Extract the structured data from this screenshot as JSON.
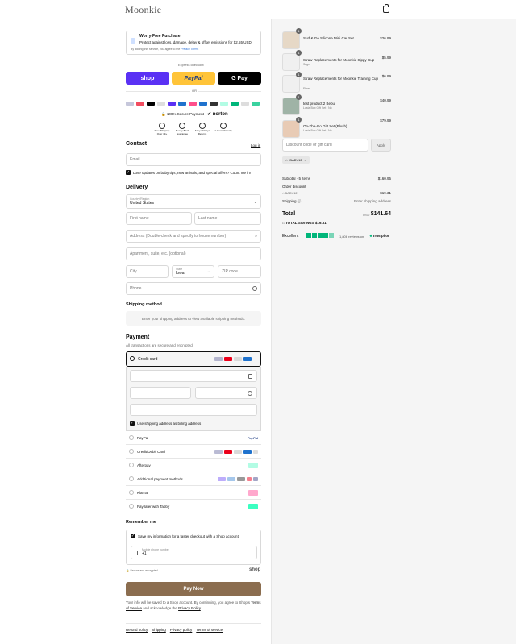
{
  "header": {
    "logo": "Moonkie"
  },
  "worry": {
    "title": "Worry-Free Purchase",
    "desc": "Protect against loss, damage, delay & offset emissions for $2.55 USD",
    "terms": "By adding this service, you agree to the",
    "terms_link": "Privacy Terms"
  },
  "express": {
    "label": "Express checkout",
    "shop": "shop",
    "paypal": "PayPal",
    "gpay": "G Pay",
    "or": "OR"
  },
  "trust": {
    "secure": "100% Secure Payment",
    "norton": "norton",
    "items": [
      "Free Shipping Over 79+",
      "Money Back Guarantee",
      "Easy 30 Days Returns",
      "1 Year Warranty"
    ]
  },
  "contact": {
    "title": "Contact",
    "login": "Log in",
    "email_placeholder": "Email",
    "newsletter": "Love updates on baby tips, new arrivals, and special offers? Count me in!"
  },
  "delivery": {
    "title": "Delivery",
    "country_label": "Country/Region",
    "country": "United States",
    "first": "First name",
    "last": "Last name",
    "address": "Address (Double-check and specify to house number)",
    "apt": "Apartment, suite, etc. (optional)",
    "city": "City",
    "state_label": "State",
    "state": "Iowa",
    "zip": "ZIP code",
    "phone": "Phone"
  },
  "shipping": {
    "title": "Shipping method",
    "msg": "Enter your shipping address to view available shipping methods."
  },
  "payment": {
    "title": "Payment",
    "subtitle": "All transactions are secure and encrypted.",
    "credit": "Credit card",
    "billing": "Use shipping address as billing address",
    "options": [
      "PayPal",
      "Credit/Debit Card",
      "Afterpay",
      "Additional payment methods",
      "Klarna",
      "Pay later with Tabby"
    ]
  },
  "remember": {
    "title": "Remember me",
    "save": "Save my information for a faster checkout with a Shop account",
    "mobile_label": "Mobile phone number",
    "mobile": "+1",
    "secure": "Secure and encrypted",
    "shop": "shop"
  },
  "paynow": "Pay Now",
  "legal": {
    "text1": "Your info will be saved to a Shop account. By continuing, you agree to Shop's",
    "tos": "Terms of Service",
    "text2": "and acknowledge the",
    "privacy": "Privacy Policy",
    "end": "."
  },
  "footer": [
    "Refund policy",
    "Shipping",
    "Privacy policy",
    "Terms of service"
  ],
  "cart": {
    "items": [
      {
        "qty": "1",
        "name": "Surf & Go Silicone Mini Car Set",
        "variant": "",
        "price": "$26.99"
      },
      {
        "qty": "1",
        "name": "Straw Replacements for Moonkie Sippy Cup",
        "variant": "Sage",
        "price": "$5.99"
      },
      {
        "qty": "1",
        "name": "Straw Replacements for Moonkie Training Cup",
        "variant": "Ether",
        "price": "$6.99"
      },
      {
        "qty": "1",
        "name": "test product 2 Bebu",
        "variant": "Lusta Box Gift Set / No",
        "price": "$40.99"
      },
      {
        "qty": "1",
        "name": "On-The-Go Gift Set (Blush)",
        "variant": "Lusta Box Gift Set / No",
        "price": "$79.99"
      }
    ],
    "discount_placeholder": "Discount code or gift card",
    "apply": "Apply",
    "code": "BABY12",
    "subtotal_label": "Subtotal · 5 items",
    "subtotal": "$160.95",
    "order_discount": "Order discount",
    "code_line": "BABY12",
    "discount_value": "– $19.31",
    "shipping_label": "Shipping",
    "shipping_value": "Enter shipping address",
    "total_label": "Total",
    "currency": "USD",
    "total": "$141.64",
    "savings_label": "TOTAL SAVINGS",
    "savings": "$19.31",
    "excellent": "Excellent",
    "reviews": "1,806 reviews on",
    "trustpilot": "Trustpilot"
  },
  "colors": {
    "shop": "#5a31f4",
    "paypal": "#ffc439",
    "gpay": "#000000",
    "paynow": "#8b6d4f",
    "stars": "#00b67a"
  }
}
